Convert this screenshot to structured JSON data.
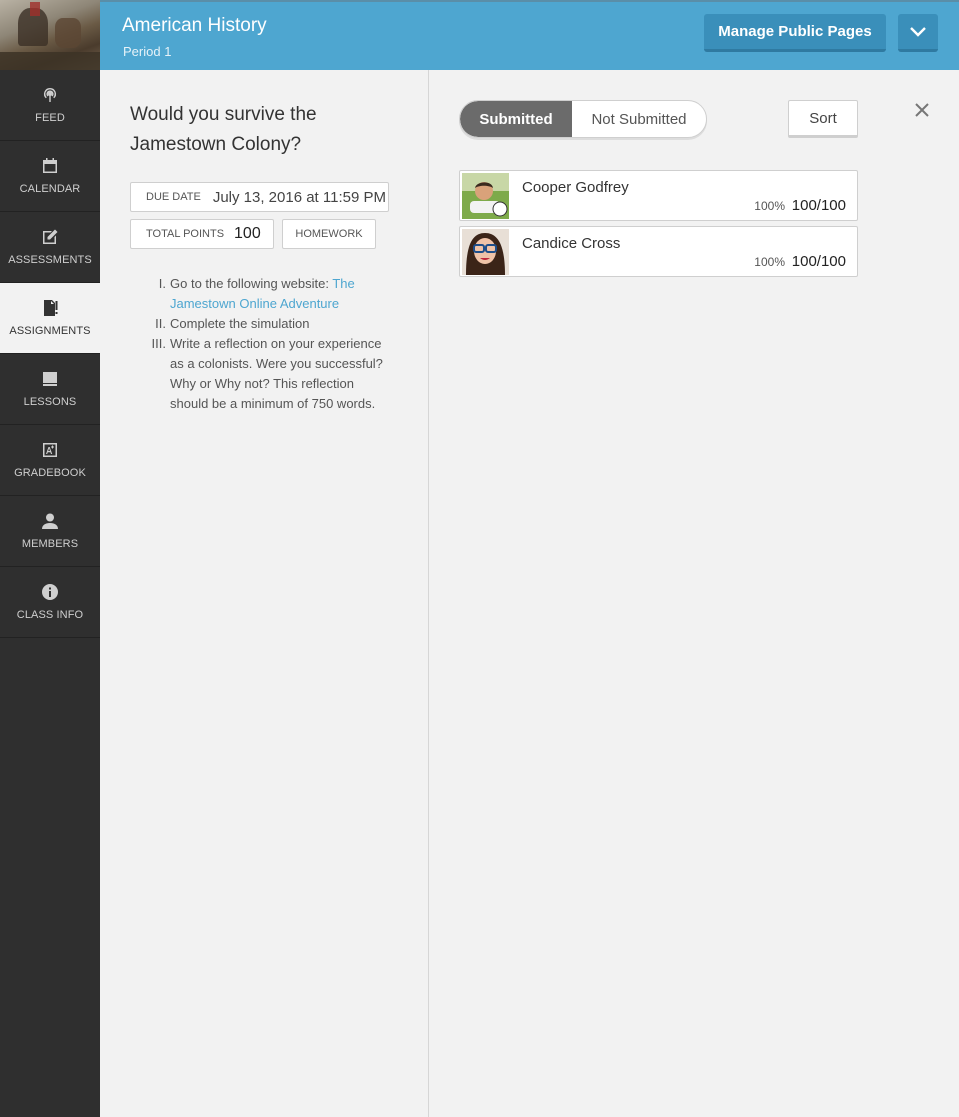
{
  "sidebar": {
    "items": [
      {
        "label": "FEED",
        "icon": "broadcast-icon"
      },
      {
        "label": "CALENDAR",
        "icon": "calendar-icon"
      },
      {
        "label": "ASSESSMENTS",
        "icon": "edit-icon"
      },
      {
        "label": "ASSIGNMENTS",
        "icon": "assignment-icon",
        "active": true
      },
      {
        "label": "LESSONS",
        "icon": "book-icon"
      },
      {
        "label": "GRADEBOOK",
        "icon": "gradebook-icon"
      },
      {
        "label": "MEMBERS",
        "icon": "person-icon"
      },
      {
        "label": "CLASS INFO",
        "icon": "info-icon"
      }
    ]
  },
  "header": {
    "title": "American History",
    "subtitle": "Period 1",
    "manage_label": "Manage Public Pages",
    "bg_color": "#4ea6d0"
  },
  "assignment": {
    "title": "Would you survive the Jamestown Colony?",
    "due_label": "DUE DATE",
    "due_value": "July 13, 2016 at 11:59 PM",
    "points_label": "TOTAL POINTS",
    "points_value": "100",
    "type_label": "HOMEWORK",
    "instructions": [
      {
        "num": "I.",
        "text": "Go to the following website: ",
        "link": "The Jamestown Online Adventure"
      },
      {
        "num": "II.",
        "text": "Complete the simulation"
      },
      {
        "num": "III.",
        "text": "Write a reflection on your experience as a colonists.  Were you successful?  Why or Why not?  This reflection should be a minimum of 750 words."
      }
    ]
  },
  "submissions": {
    "tab_submitted": "Submitted",
    "tab_not_submitted": "Not Submitted",
    "sort_label": "Sort",
    "students": [
      {
        "name": "Cooper Godfrey",
        "percent": "100%",
        "score": "100/100"
      },
      {
        "name": "Candice Cross",
        "percent": "100%",
        "score": "100/100"
      }
    ]
  }
}
